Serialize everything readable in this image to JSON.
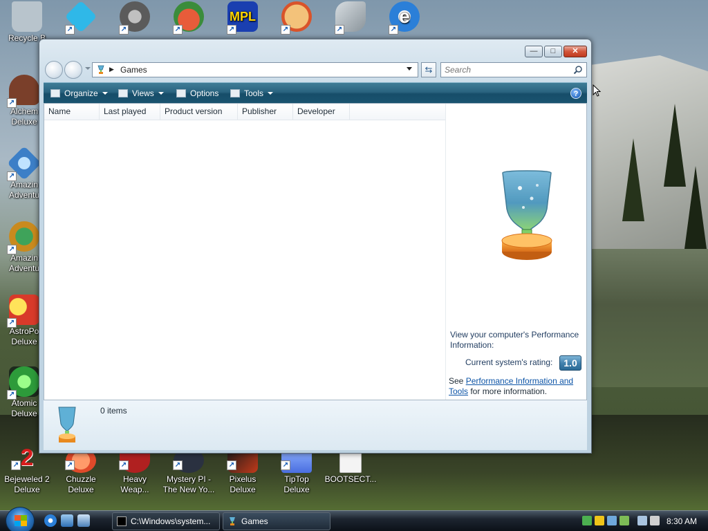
{
  "desktop": {
    "top_icons": [
      {
        "label": "Recycle B",
        "icon": "recycle-bin-icon",
        "color": "#b8c4cc"
      },
      {
        "label": "",
        "icon": "diamond-game-icon",
        "color": "#2fb8e8"
      },
      {
        "label": "",
        "icon": "gear-game-icon",
        "color": "#5b5b5b"
      },
      {
        "label": "",
        "icon": "bird-game-icon",
        "color": "#d63a2c"
      },
      {
        "label": "",
        "icon": "mpl-game-icon",
        "color": "#1a3fb0"
      },
      {
        "label": "",
        "icon": "pizza-game-icon",
        "color": "#e0642a"
      },
      {
        "label": "",
        "icon": "shark-game-icon",
        "color": "#9aa5ad"
      },
      {
        "label": "",
        "icon": "internet-explorer-icon",
        "color": "#2b7fd8"
      }
    ],
    "left_icons": [
      {
        "label1": "Alchem",
        "label2": "Deluxe",
        "icon": "alchemy-icon",
        "color": "#7a3f2a"
      },
      {
        "label1": "Amazin",
        "label2": "Adventu",
        "icon": "amazing-adventures-icon",
        "color": "#3c7fc7"
      },
      {
        "label1": "Amazin",
        "label2": "Adventu",
        "icon": "amazing-adventures-globe-icon",
        "color": "#2e8c4a"
      },
      {
        "label1": "AstroPo",
        "label2": "Deluxe",
        "icon": "astropop-icon",
        "color": "#e8b020"
      },
      {
        "label1": "Atomic",
        "label2": "Deluxe",
        "icon": "atomic-icon",
        "color": "#2d9b3a"
      }
    ],
    "bottom_icons": [
      {
        "label1": "Bejeweled 2",
        "label2": "Deluxe",
        "icon": "bejeweled-icon",
        "color": "#d81c1c"
      },
      {
        "label1": "Chuzzle",
        "label2": "Deluxe",
        "icon": "chuzzle-icon",
        "color": "#e04a2a"
      },
      {
        "label1": "Heavy",
        "label2": "Weap...",
        "icon": "heavy-weapon-icon",
        "color": "#b02020"
      },
      {
        "label1": "Mystery PI -",
        "label2": "The New Yo...",
        "icon": "mystery-pi-icon",
        "color": "#2a3140"
      },
      {
        "label1": "Pixelus Deluxe",
        "label2": "",
        "icon": "pixelus-icon",
        "color": "#c23a1a"
      },
      {
        "label1": "TipTop",
        "label2": "Deluxe",
        "icon": "tiptop-icon",
        "color": "#4a6ee0"
      },
      {
        "label1": "BOOTSECT...",
        "label2": "",
        "icon": "blank-file-icon",
        "color": "#f4f4f4"
      }
    ]
  },
  "window": {
    "title_buttons": {
      "minimize": "—",
      "maximize": "□",
      "close": "✕"
    },
    "address": {
      "crumb": "Games"
    },
    "search": {
      "placeholder": "Search"
    },
    "toolbar": {
      "organize": "Organize",
      "views": "Views",
      "options": "Options",
      "tools": "Tools",
      "help": "?"
    },
    "columns": [
      "Name",
      "Last played",
      "Product version",
      "Publisher",
      "Developer"
    ],
    "preview": {
      "perf_title": "View your computer's Performance Information:",
      "rating_label": "Current system's rating:",
      "rating_value": "1.0",
      "see_prefix": "See ",
      "link_text": "Performance Information and Tools",
      "see_suffix": " for more information."
    },
    "details": {
      "items_count": "0 items"
    }
  },
  "taskbar": {
    "tasks": [
      {
        "label": "C:\\Windows\\system...",
        "icon": "cmd-icon"
      },
      {
        "label": "Games",
        "icon": "games-icon"
      }
    ],
    "clock": "8:30 AM"
  },
  "colors": {
    "toolbar_bg": "#1a5470",
    "link": "#0b53a6",
    "rating_badge": "#3f7fab"
  }
}
